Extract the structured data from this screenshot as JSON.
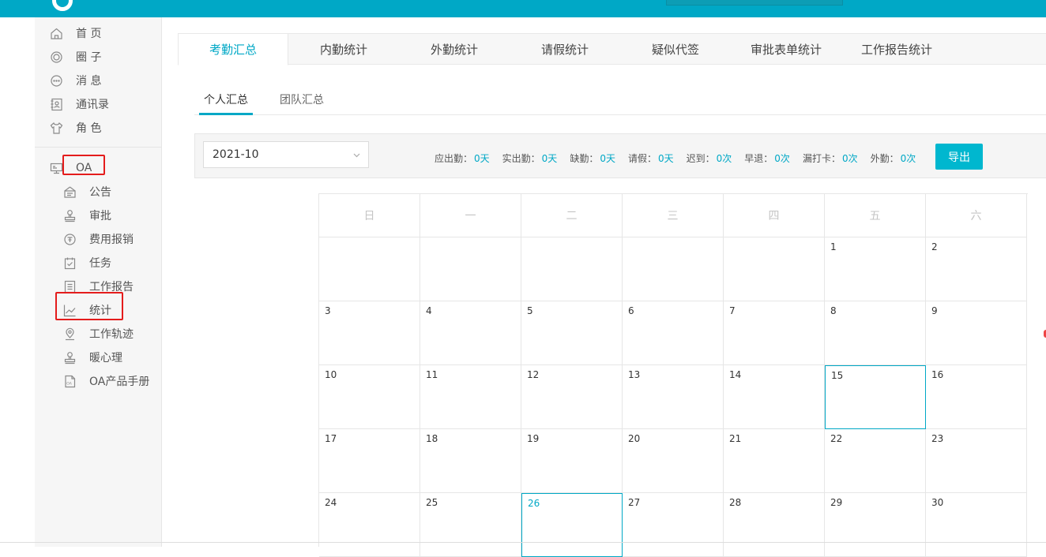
{
  "colors": {
    "accent": "#00a8c6",
    "highlight": "#e41c1c"
  },
  "sidebar": {
    "top_items": [
      {
        "label": "首 页",
        "icon": "home-icon"
      },
      {
        "label": "圈 子",
        "icon": "circle-icon"
      },
      {
        "label": "消 息",
        "icon": "message-icon"
      },
      {
        "label": "通讯录",
        "icon": "contacts-icon"
      },
      {
        "label": "角 色",
        "icon": "shirt-icon"
      }
    ],
    "oa_label": "OA",
    "oa_items": [
      {
        "label": "公告",
        "icon": "notice-icon"
      },
      {
        "label": "审批",
        "icon": "stamp-icon"
      },
      {
        "label": "费用报销",
        "icon": "expense-icon"
      },
      {
        "label": "任务",
        "icon": "task-icon"
      },
      {
        "label": "工作报告",
        "icon": "report-icon"
      },
      {
        "label": "统计",
        "icon": "chart-icon"
      },
      {
        "label": "工作轨迹",
        "icon": "location-icon"
      },
      {
        "label": "暖心理",
        "icon": "stamp-icon"
      },
      {
        "label": "OA产品手册",
        "icon": "oa-manual-icon"
      }
    ]
  },
  "tabs": [
    "考勤汇总",
    "内勤统计",
    "外勤统计",
    "请假统计",
    "疑似代签",
    "审批表单统计",
    "工作报告统计"
  ],
  "active_tab": "考勤汇总",
  "subtabs": [
    "个人汇总",
    "团队汇总"
  ],
  "active_subtab": "个人汇总",
  "filter": {
    "month": "2021-10",
    "stats": [
      {
        "label": "应出勤：",
        "value": "0天"
      },
      {
        "label": "实出勤：",
        "value": "0天"
      },
      {
        "label": "缺勤：",
        "value": "0天"
      },
      {
        "label": "请假：",
        "value": "0天"
      },
      {
        "label": "迟到：",
        "value": "0次"
      },
      {
        "label": "早退：",
        "value": "0次"
      },
      {
        "label": "漏打卡：",
        "value": "0次"
      },
      {
        "label": "外勤：",
        "value": "0次"
      }
    ],
    "export_label": "导出"
  },
  "calendar": {
    "weekdays": [
      "日",
      "一",
      "二",
      "三",
      "四",
      "五",
      "六"
    ],
    "weeks": [
      [
        "",
        "",
        "",
        "",
        "",
        "1",
        "2"
      ],
      [
        "3",
        "4",
        "5",
        "6",
        "7",
        "8",
        "9"
      ],
      [
        "10",
        "11",
        "12",
        "13",
        "14",
        "15",
        "16"
      ],
      [
        "17",
        "18",
        "19",
        "20",
        "21",
        "22",
        "23"
      ],
      [
        "24",
        "25",
        "26",
        "27",
        "28",
        "29",
        "30"
      ]
    ],
    "selected_day": "15",
    "today": "26"
  }
}
